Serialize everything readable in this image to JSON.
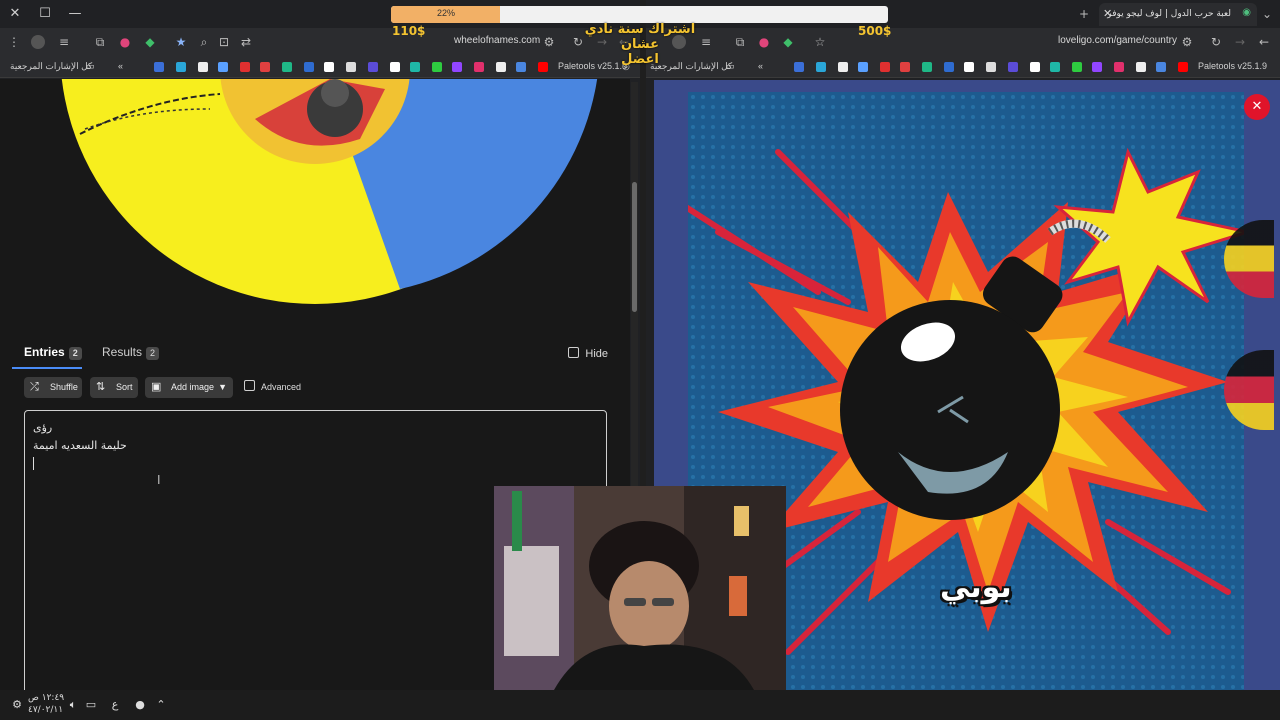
{
  "left_browser": {
    "url": "wheelofnames.com",
    "bookmarks_all": "كل الإشارات المرجعية",
    "bookmark_paletools": "Paletools v25.1.9"
  },
  "wheel_app": {
    "tabs": [
      {
        "label": "Entries",
        "count": "2"
      },
      {
        "label": "Results",
        "count": "2"
      }
    ],
    "hide_label": "Hide",
    "buttons": {
      "shuffle": "Shuffle",
      "sort": "Sort",
      "add_image": "Add image",
      "advanced": "Advanced"
    },
    "entries": [
      "رؤى",
      "حليمة السعديه اميمة"
    ],
    "wheel_colors": {
      "yellow": "#f7ee1e",
      "blue": "#4a86e0"
    }
  },
  "overlay": {
    "progress_text": "22%",
    "progress_value": 0.22,
    "price_left": "110$",
    "price_right": "500$",
    "promo_line1": "اشتراك سنة نادي عشان",
    "promo_line2": "اعضل"
  },
  "right_browser": {
    "tab_title": "لعبة حرب الدول | لوف ليجو يوفر",
    "url": "loveligo.com/game/country",
    "bookmarks_all": "كل الإشارات المرجعية",
    "bookmark_paletools": "Paletools v25.1.9",
    "game_text": "بوبي"
  },
  "taskbar": {
    "time": "١٢:٤٩ ص",
    "date": "٤٧/٠٢/١١",
    "lang": "ع"
  }
}
